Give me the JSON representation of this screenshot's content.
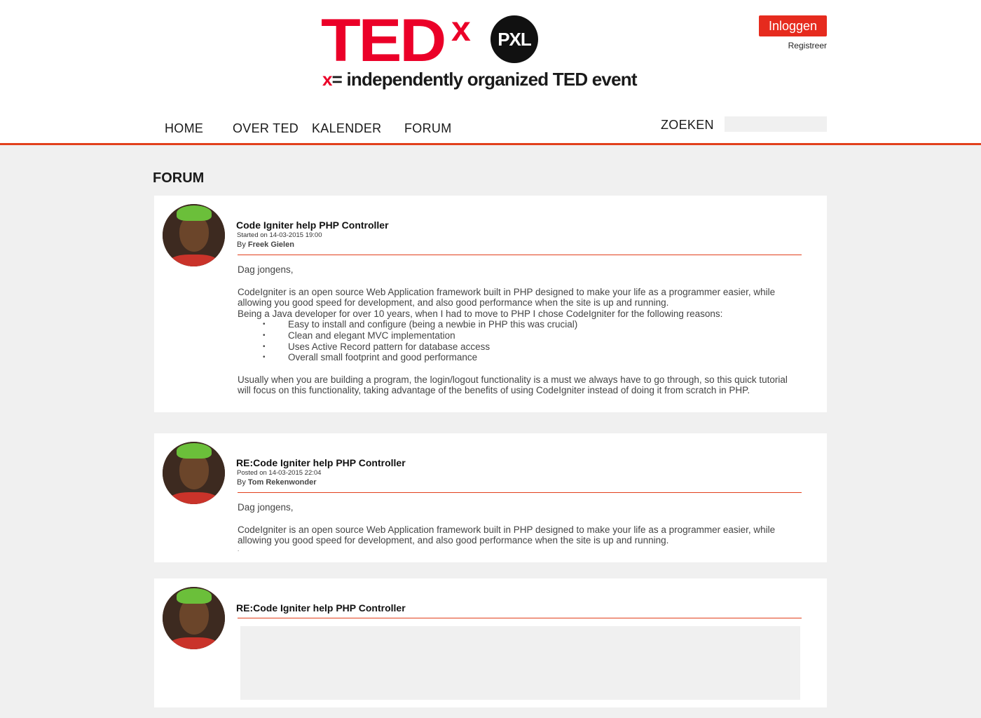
{
  "header": {
    "logo_ted": "TED",
    "logo_x": "x",
    "logo_pxl": "PXL",
    "logo_tag_x": "x",
    "logo_tag_rest": "= independently organized TED event",
    "login_label": "Inloggen",
    "register_label": "Registreer"
  },
  "nav": {
    "items": [
      {
        "label": "HOME"
      },
      {
        "label": "OVER TED"
      },
      {
        "label": "KALENDER"
      },
      {
        "label": "FORUM"
      }
    ],
    "search_label": "ZOEKEN",
    "search_value": ""
  },
  "page": {
    "title": "FORUM"
  },
  "posts": [
    {
      "title": "Code Igniter help PHP Controller",
      "meta": "Started on 14-03-2015 19:00",
      "by_prefix": "By ",
      "author": "Freek Gielen",
      "greeting": "Dag jongens,",
      "para1": "CodeIgniter is an open source Web Application framework built in PHP designed to make your life as a programmer easier, while allowing you good speed for development, and also good performance when the site is up and running.",
      "para2": "Being a Java developer for over 10 years, when I had to move to PHP I chose CodeIgniter for the following reasons:",
      "bullets": [
        "Easy to install and configure (being a newbie in PHP this was crucial)",
        "Clean and elegant MVC implementation",
        "Uses Active Record pattern for database access",
        "Overall small footprint and good performance"
      ],
      "para3": "Usually when you are building a program, the login/logout functionality is a must we always have to go through, so this quick tutorial will focus on this functionality, taking advantage of the benefits of using CodeIgniter instead of doing it from scratch in PHP."
    },
    {
      "title": "RE:Code Igniter help PHP Controller",
      "meta": "Posted on 14-03-2015 22:04",
      "by_prefix": "By ",
      "author": "Tom Rekenwonder",
      "greeting": "Dag jongens,",
      "para1": "CodeIgniter is an open source Web Application framework built in PHP designed to make your life as a programmer easier, while allowing you good speed for development, and also good performance when the site is up and running.",
      "trailing": "."
    },
    {
      "title": "RE:Code Igniter help PHP Controller",
      "reply_value": ""
    }
  ]
}
